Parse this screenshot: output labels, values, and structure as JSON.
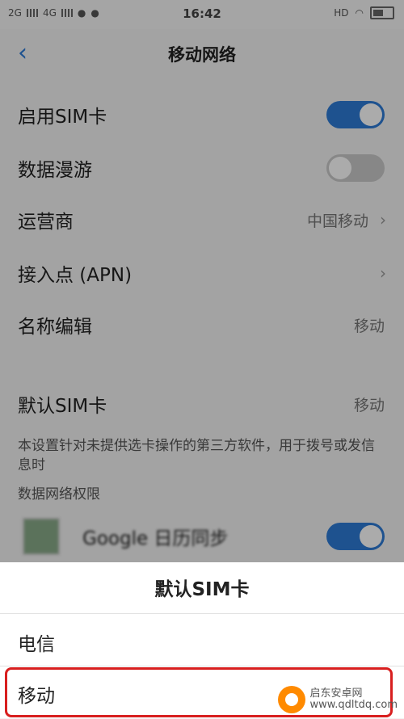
{
  "status_bar": {
    "network1": "2G",
    "network2": "4G",
    "time": "16:42",
    "hd": "HD"
  },
  "header": {
    "back_glyph": "‹",
    "title": "移动网络"
  },
  "rows": [
    {
      "label": "启用SIM卡",
      "toggle": "on"
    },
    {
      "label": "数据漫游",
      "toggle": "off"
    },
    {
      "label": "运营商",
      "value": "中国移动",
      "chevron": "›"
    },
    {
      "label": "接入点 (APN)",
      "chevron": "›"
    },
    {
      "label": "名称编辑",
      "value": "移动"
    },
    {
      "label": "默认SIM卡",
      "value": "移动"
    }
  ],
  "default_sim_note": "本设置针对未提供选卡操作的第三方软件，用于拨号或发信息时",
  "section_header": "数据网络权限",
  "app_row": {
    "label": "Google 日历同步",
    "toggle": "on"
  },
  "sheet": {
    "title": "默认SIM卡",
    "options": [
      "电信",
      "移动"
    ],
    "highlight_color": "#d81f1f"
  },
  "watermark": {
    "line1": "启东安卓网",
    "line2": "www.qdltdq.com"
  },
  "colors": {
    "accent": "#2e7bd6",
    "toggle_off": "#c9c9c9"
  }
}
